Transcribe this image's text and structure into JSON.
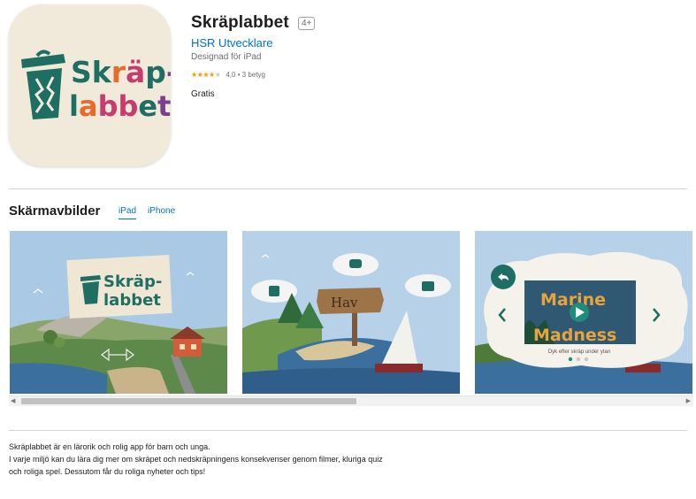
{
  "app": {
    "name": "Skräplabbet",
    "age_rating": "4+",
    "developer": "HSR Utvecklare",
    "designed_for": "Designad för iPad",
    "rating_value": "4,0",
    "rating_count": "• 3 betyg",
    "stars": 4,
    "price": "Gratis"
  },
  "logo": {
    "line1": "Skräp-",
    "line2": "labbet"
  },
  "screenshots": {
    "title": "Skärmavbilder",
    "tabs": [
      {
        "label": "iPad",
        "active": true
      },
      {
        "label": "iPhone",
        "active": false
      }
    ],
    "items": [
      {
        "logo_line1": "Skräp-",
        "logo_line2": "labbet"
      },
      {
        "sign_text": "Hav"
      },
      {
        "video_title_line1": "Marine",
        "video_title_line2": "Madness",
        "caption": "Dyk efter skräp under ytan"
      }
    ]
  },
  "description": {
    "lines": [
      "Skräplabbet är en lärorik och rolig app för barn och unga.",
      "I varje miljö kan du lära dig mer om skräpet och nedskräpningens konsekvenser genom filmer, kluriga quiz",
      "och roliga spel. Dessutom får du roliga nyheter och tips!"
    ]
  },
  "colors": {
    "accent": "#0070c9",
    "star": "#ff9500",
    "bin_green": "#1e6e63",
    "sky": "#a9c9e4",
    "sea": "#3a6f9e"
  },
  "icons": {
    "star": "star-icon",
    "scroll_left": "chevron-left-icon",
    "scroll_right": "chevron-right-icon",
    "play": "play-icon"
  }
}
